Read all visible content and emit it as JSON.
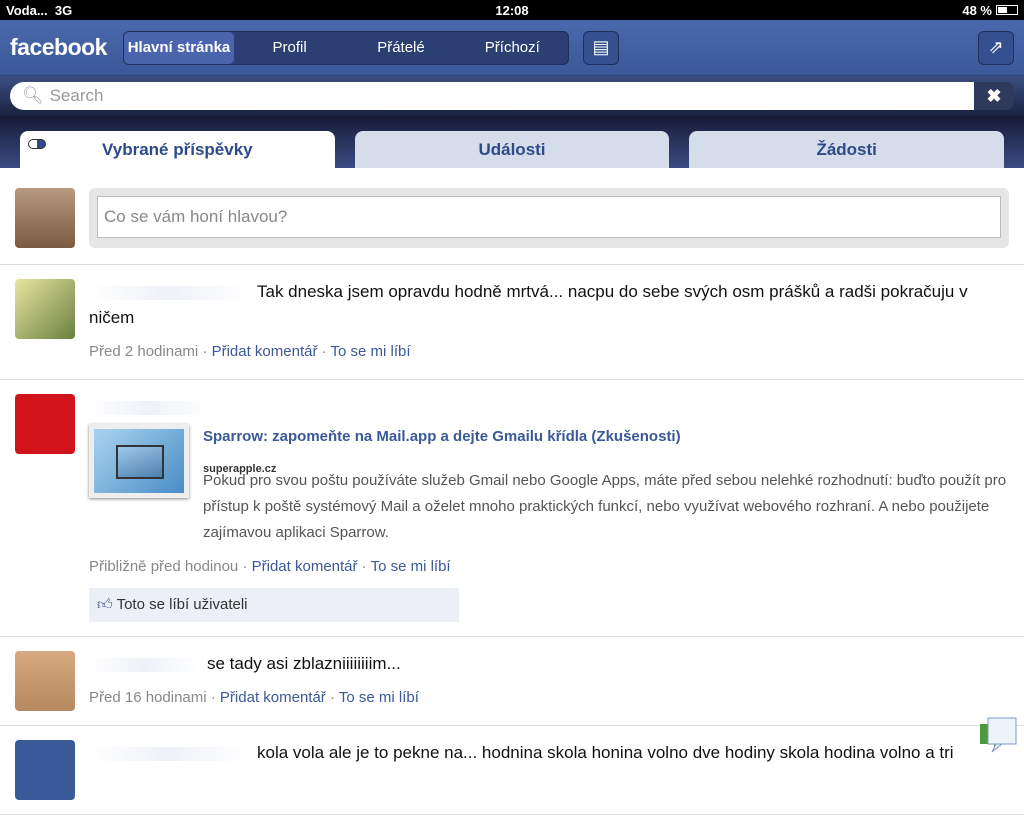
{
  "status": {
    "carrier": "Voda...",
    "network": "3G",
    "time": "12:08",
    "battery": "48 %"
  },
  "nav": {
    "logo": "facebook",
    "tabs": [
      "Hlavní stránka",
      "Profil",
      "Přátelé",
      "Příchozí"
    ]
  },
  "search": {
    "placeholder": "Search"
  },
  "tabs": [
    "Vybrané příspěvky",
    "Události",
    "Žádosti"
  ],
  "composer": {
    "placeholder": "Co se vám honí hlavou?"
  },
  "posts": [
    {
      "text": "Tak dneska jsem opravdu hodně mrtvá... nacpu do sebe svých osm prášků a radši pokračuju v ničem",
      "time": "Před 2 hodinami",
      "comment": "Přidat komentář",
      "like": "To se mi líbí"
    },
    {
      "link_title": "Sparrow: zapomeňte na Mail.app a dejte Gmailu křídla (Zkušenosti)",
      "link_source": "superapple.cz",
      "link_desc": "Pokud pro svou poštu používáte služeb Gmail nebo Google Apps, máte před sebou nelehké rozhodnutí: buďto použít pro přístup k poště systémový Mail a oželet mnoho praktických funkcí, nebo využívat webového rozhraní. A nebo použijete zajímavou aplikaci Sparrow.",
      "time": "Přibližně před hodinou",
      "comment": "Přidat komentář",
      "like": "To se mi líbí",
      "likes": "Toto se líbí uživateli"
    },
    {
      "text": "se tady asi zblazniiiiiiiim...",
      "time": "Před 16 hodinami",
      "comment": "Přidat komentář",
      "like": "To se mi líbí"
    },
    {
      "text": "kola vola ale je to pekne na... hodnina skola honina volno dve hodiny skola hodina volno a tri"
    }
  ],
  "sep": " · "
}
